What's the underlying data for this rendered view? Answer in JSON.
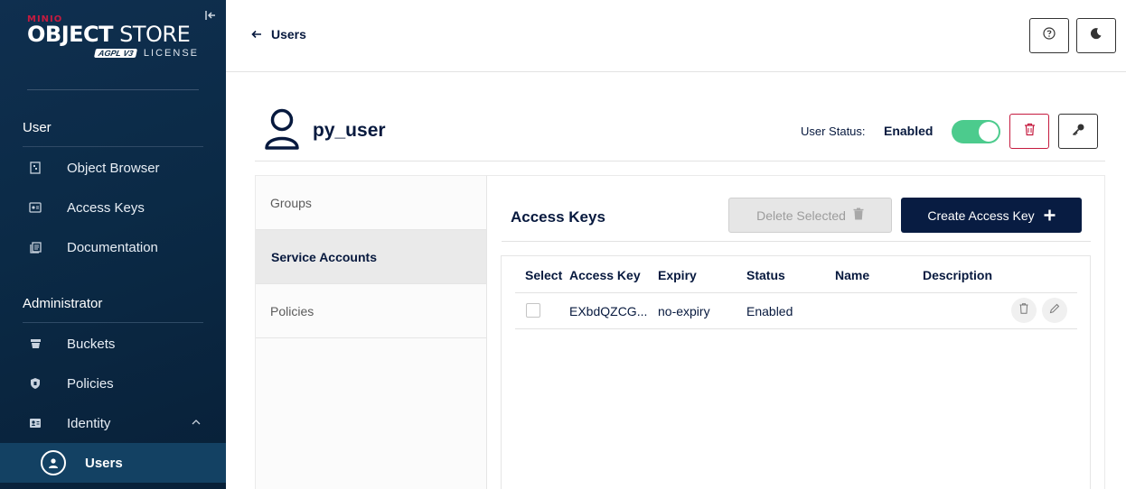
{
  "sidebar": {
    "logo": {
      "brand": "MINIO",
      "product_bold": "OBJECT",
      "product_light": " STORE",
      "badge": "AGPL V3",
      "license": "LICENSE"
    },
    "sections": [
      {
        "title": "User",
        "items": [
          {
            "label": "Object Browser",
            "icon": "object-browser-icon"
          },
          {
            "label": "Access Keys",
            "icon": "access-keys-icon"
          },
          {
            "label": "Documentation",
            "icon": "documentation-icon"
          }
        ]
      },
      {
        "title": "Administrator",
        "items": [
          {
            "label": "Buckets",
            "icon": "buckets-icon"
          },
          {
            "label": "Policies",
            "icon": "policies-icon"
          },
          {
            "label": "Identity",
            "icon": "identity-icon",
            "expanded": true
          },
          {
            "label": "Users",
            "icon": "user-circle-icon",
            "active": true
          }
        ]
      }
    ]
  },
  "header": {
    "back_label": "Users"
  },
  "user": {
    "name": "py_user",
    "status_label": "User Status:",
    "status_value": "Enabled",
    "enabled": true
  },
  "tabs": [
    {
      "label": "Groups"
    },
    {
      "label": "Service Accounts",
      "active": true
    },
    {
      "label": "Policies"
    }
  ],
  "content": {
    "title": "Access Keys",
    "delete_selected_label": "Delete Selected",
    "create_label": "Create Access Key"
  },
  "table": {
    "columns": [
      "Select",
      "Access Key",
      "Expiry",
      "Status",
      "Name",
      "Description"
    ],
    "rows": [
      {
        "access_key": "EXbdQZCG...",
        "expiry": "no-expiry",
        "status": "Enabled",
        "name": "",
        "description": ""
      }
    ]
  },
  "colors": {
    "sidebar_bg": "#0b2a46",
    "primary": "#081c42",
    "danger": "#c51b3f",
    "toggle_on": "#4ccb8d"
  }
}
